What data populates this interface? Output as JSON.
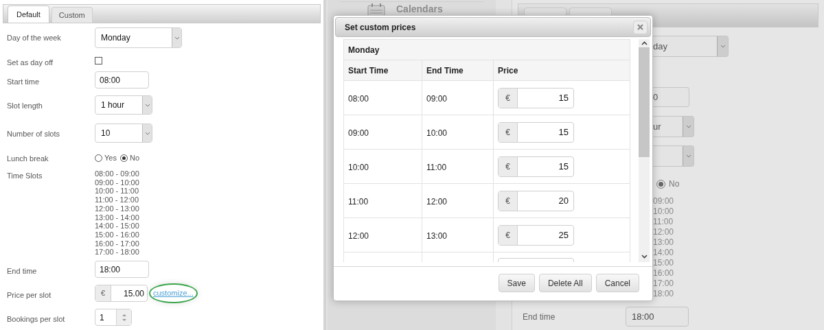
{
  "settings_panel": {
    "tabs": [
      {
        "label": "Default",
        "selected": true
      },
      {
        "label": "Custom",
        "selected": false
      }
    ],
    "fields": [
      {
        "kind": "select",
        "label": "Day of the week",
        "value": "Monday"
      },
      {
        "kind": "checkbox",
        "label": "Set as day off",
        "checked": false
      },
      {
        "kind": "text",
        "label": "Start time",
        "value": "08:00"
      },
      {
        "kind": "select",
        "label": "Slot length",
        "value": "1 hour"
      },
      {
        "kind": "select",
        "label": "Number of slots",
        "value": "10"
      },
      {
        "kind": "radio",
        "label": "Lunch break",
        "options": [
          {
            "label": "Yes",
            "selected": false
          },
          {
            "label": "No",
            "selected": true
          }
        ]
      },
      {
        "kind": "list",
        "label": "Time Slots",
        "items": [
          "08:00 - 09:00",
          "09:00 - 10:00",
          "10:00 - 11:00",
          "11:00 - 12:00",
          "12:00 - 13:00",
          "13:00 - 14:00",
          "14:00 - 15:00",
          "15:00 - 16:00",
          "16:00 - 17:00",
          "17:00 - 18:00"
        ]
      },
      {
        "kind": "text",
        "label": "End time",
        "value": "18:00"
      },
      {
        "kind": "price",
        "label": "Price per slot",
        "currency": "€",
        "value": "15.00",
        "link": "customize..."
      },
      {
        "kind": "spinner",
        "label": "Bookings per slot",
        "value": "1"
      }
    ]
  },
  "background": {
    "sidebar_item": "Calendars",
    "fields": [
      {
        "kind": "select",
        "value": "day"
      },
      {
        "kind": "text",
        "value": "0"
      },
      {
        "kind": "select",
        "value": "ur"
      },
      {
        "kind": "select"
      },
      {
        "kind": "radio",
        "options": [
          {
            "label": "No",
            "selected": true
          }
        ]
      },
      {
        "kind": "list",
        "items": [
          "09:00",
          "10:00",
          "11:00",
          "12:00",
          "13:00",
          "14:00",
          "15:00",
          "16:00",
          "17:00",
          "18:00"
        ]
      },
      {
        "kind": "text",
        "label": "End time",
        "value": "18:00"
      }
    ]
  },
  "dialog": {
    "title": "Set custom prices",
    "day": "Monday",
    "columns": [
      "Start Time",
      "End Time",
      "Price"
    ],
    "rows": [
      {
        "start": "08:00",
        "end": "09:00",
        "currency": "€",
        "price": "15"
      },
      {
        "start": "09:00",
        "end": "10:00",
        "currency": "€",
        "price": "15"
      },
      {
        "start": "10:00",
        "end": "11:00",
        "currency": "€",
        "price": "15"
      },
      {
        "start": "11:00",
        "end": "12:00",
        "currency": "€",
        "price": "20"
      },
      {
        "start": "12:00",
        "end": "13:00",
        "currency": "€",
        "price": "25"
      }
    ],
    "buttons": [
      "Save",
      "Delete All",
      "Cancel"
    ]
  }
}
